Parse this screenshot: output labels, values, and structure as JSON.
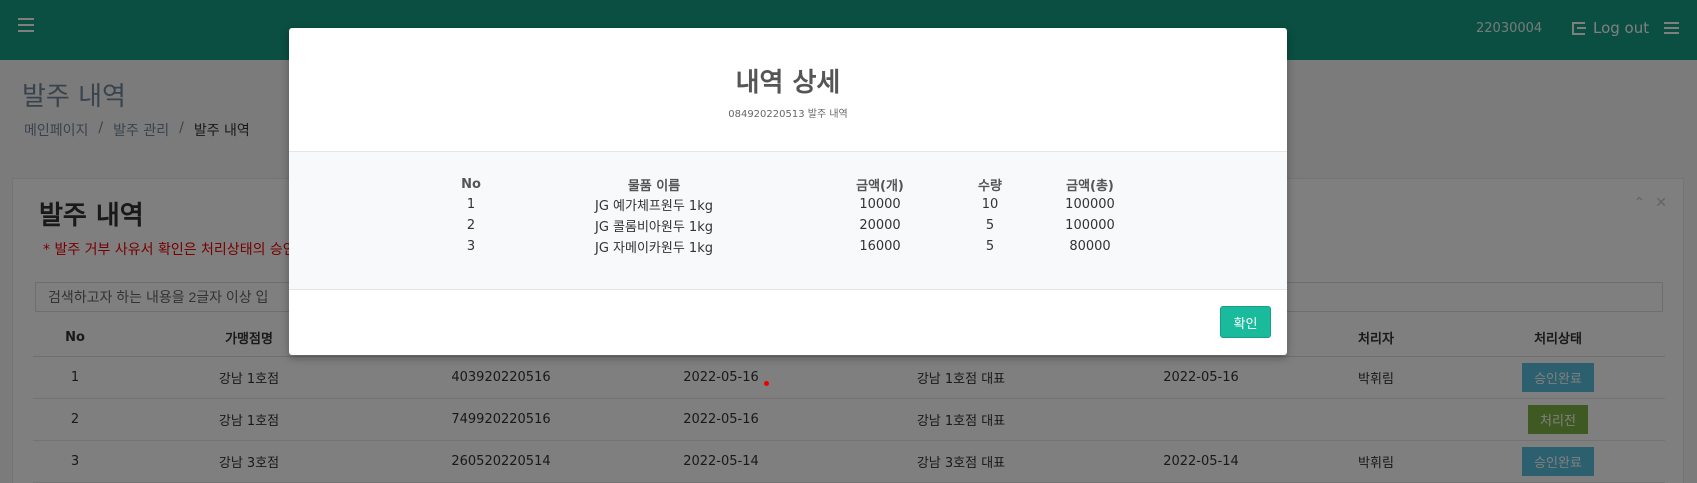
{
  "header": {
    "user_id": "22030004",
    "logout_label": "Log out"
  },
  "page": {
    "title": "발주 내역",
    "breadcrumb": [
      "메인페이지",
      "발주 관리",
      "발주 내역"
    ]
  },
  "panel": {
    "title": "발주 내역",
    "notice": "* 발주 거부 사유서 확인은 처리상태의 승인",
    "search_placeholder": "검색하고자 하는 내용을 2글자 이상 입",
    "columns": [
      "No",
      "가맹점명",
      "",
      "",
      "",
      "",
      "처리자",
      "처리상태"
    ],
    "rows": [
      {
        "no": "1",
        "store": "강남 1호점",
        "order_no": "403920220516",
        "date": "2022-05-16",
        "requester": "강남 1호점 대표",
        "proc_date": "2022-05-16",
        "handler": "박휘림",
        "status": "승인완료",
        "status_color": "#5bc0de"
      },
      {
        "no": "2",
        "store": "강남 1호점",
        "order_no": "749920220516",
        "date": "2022-05-16",
        "requester": "강남 1호점 대표",
        "proc_date": "",
        "handler": "",
        "status": "처리전",
        "status_color": "#7cb342"
      },
      {
        "no": "3",
        "store": "강남 3호점",
        "order_no": "260520220514",
        "date": "2022-05-14",
        "requester": "강남 3호점 대표",
        "proc_date": "2022-05-14",
        "handler": "박휘림",
        "status": "승인완료",
        "status_color": "#5bc0de"
      }
    ]
  },
  "modal": {
    "title": "내역 상세",
    "subtitle": "084920220513 발주 내역",
    "columns": [
      "No",
      "물품 이름",
      "금액(개)",
      "수량",
      "금액(총)"
    ],
    "items": [
      {
        "no": "1",
        "name": "JG 예가체프원두 1kg",
        "price": "10000",
        "qty": "10",
        "total": "100000"
      },
      {
        "no": "2",
        "name": "JG 콜롬비아원두 1kg",
        "price": "20000",
        "qty": "5",
        "total": "100000"
      },
      {
        "no": "3",
        "name": "JG 자메이카원두 1kg",
        "price": "16000",
        "qty": "5",
        "total": "80000"
      }
    ],
    "confirm_label": "확인"
  },
  "colors": {
    "topbar": "#169f85",
    "confirm": "#1abb9c",
    "approved": "#5bc0de",
    "pending": "#7cb342"
  }
}
